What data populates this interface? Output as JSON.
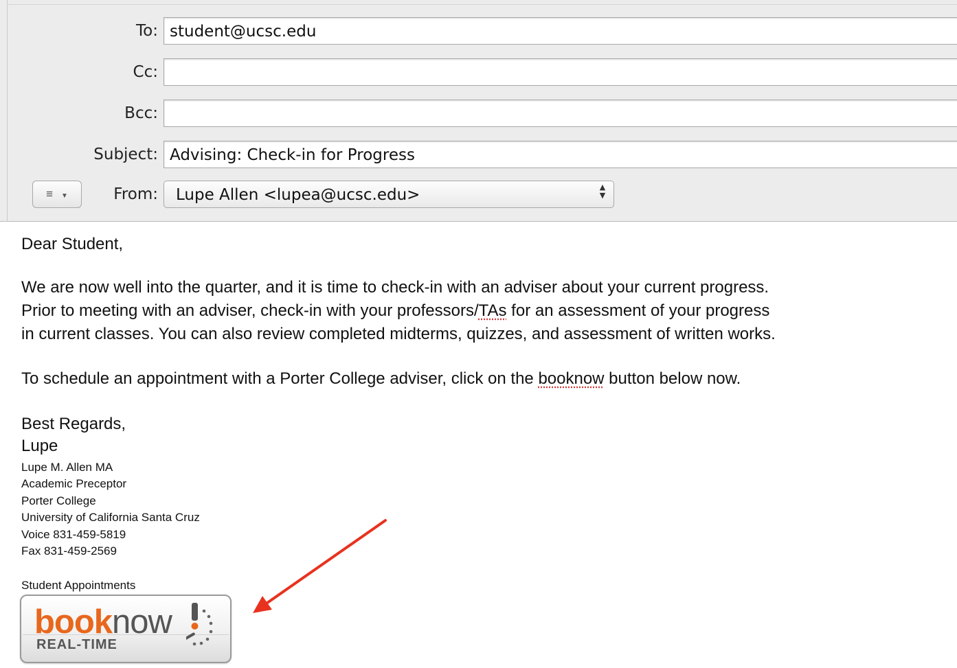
{
  "compose": {
    "to": {
      "label": "To:",
      "value": "student@ucsc.edu"
    },
    "cc": {
      "label": "Cc:",
      "value": ""
    },
    "bcc": {
      "label": "Bcc:",
      "value": ""
    },
    "subject": {
      "label": "Subject:",
      "value": "Advising: Check-in for Progress"
    },
    "from": {
      "label": "From:",
      "value": "Lupe Allen <lupea@ucsc.edu>"
    },
    "format_button": {
      "icon": "list-icon",
      "arrow": "chevron-down-icon"
    }
  },
  "message": {
    "greeting": "Dear Student,",
    "para1_lines": [
      "We are now well into the quarter, and it is time to check-in with an adviser about your current progress.",
      "Prior to meeting with an adviser, check-in with your professors/",
      "TAs",
      " for an assessment of your progress",
      "in current classes.  You can also review completed midterms, quizzes, and assessment of written works."
    ],
    "para2_before": "To schedule an appointment with a Porter College adviser, click on the ",
    "para2_link": "booknow",
    "para2_after": " button below now.",
    "closing": "Best Regards,",
    "sender_short": "Lupe",
    "signature": [
      "Lupe M. Allen MA",
      "Academic Preceptor",
      "Porter College",
      "University of California Santa Cruz",
      "Voice 831-459-5819",
      "Fax   831-459-2569"
    ],
    "appointments_label": "Student Appointments"
  },
  "booknow_button": {
    "book": "book",
    "now": "now",
    "realtime": "REAL-TIME",
    "accent": "#e8671c"
  },
  "annotation": {
    "arrow_color": "#e8321f"
  }
}
